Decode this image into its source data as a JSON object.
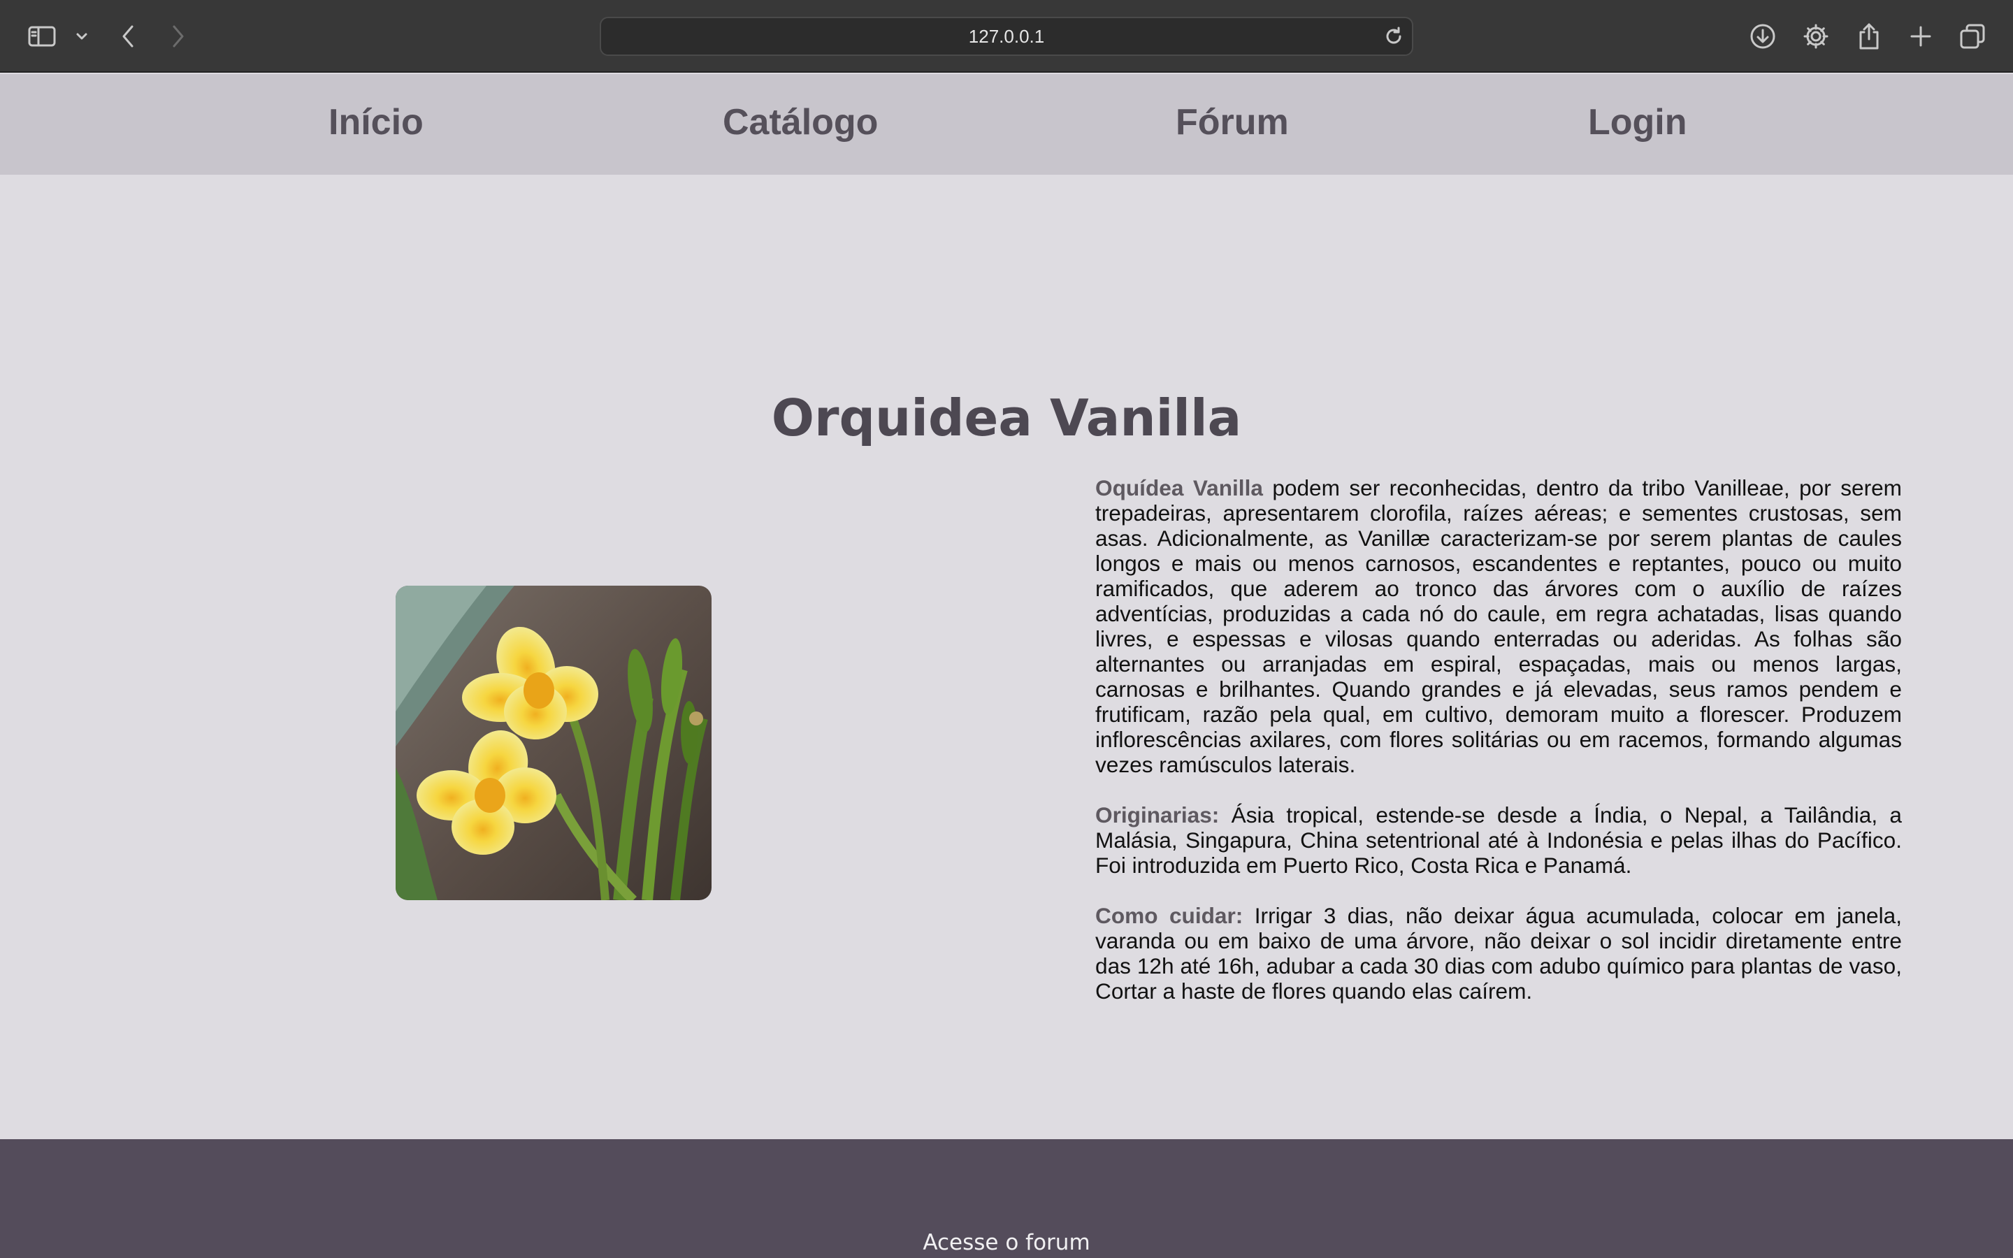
{
  "browser": {
    "url": "127.0.0.1",
    "icons": [
      "sidebar-icon",
      "chevron-down-icon",
      "back-icon",
      "forward-icon",
      "reload-icon",
      "download-icon",
      "gear-icon",
      "share-icon",
      "plus-icon",
      "tabs-icon"
    ]
  },
  "nav": {
    "items": [
      {
        "label": "Início"
      },
      {
        "label": "Catálogo"
      },
      {
        "label": "Fórum"
      },
      {
        "label": "Login"
      }
    ]
  },
  "main": {
    "title": "Orquidea Vanilla",
    "paragraphs": [
      {
        "lead": "Oquídea Vanilla",
        "text": " podem ser reconhecidas, dentro da tribo Vanilleae, por serem trepadeiras, apresentarem clorofila, raízes aéreas; e sementes crustosas, sem asas. Adicionalmente, as Vanillæ caracterizam-se por serem plantas de caules longos e mais ou menos carnosos, escandentes e reptantes, pouco ou muito ramificados, que aderem ao tronco das árvores com o auxílio de raízes adventícias, produzidas a cada nó do caule, em regra achatadas, lisas quando livres, e espessas e vilosas quando enterradas ou aderidas. As folhas são alternantes ou arranjadas em espiral, espaçadas, mais ou menos largas, carnosas e brilhantes. Quando grandes e já elevadas, seus ramos pendem e frutificam, razão pela qual, em cultivo, demoram muito a florescer. Produzem inflorescências axilares, com flores solitárias ou em racemos, formando algumas vezes ramúsculos laterais."
      },
      {
        "lead": "Originarias:",
        "text": " Ásia tropical, estende-se desde a Índia, o Nepal, a Tailândia, a Malásia, Singapura, China setentrional até à Indonésia e pelas ilhas do Pacífico. Foi introduzida em Puerto Rico, Costa Rica e Panamá."
      },
      {
        "lead": "Como cuidar:",
        "text": " Irrigar 3 dias, não deixar água acumulada, colocar em janela, varanda ou em baixo de uma árvore, não deixar o sol incidir diretamente entre das 12h até 16h, adubar a cada 30 dias com adubo químico para plantas de vaso, Cortar a haste de flores quando elas caírem."
      }
    ]
  },
  "footer": {
    "link": "Acesse o forum"
  }
}
